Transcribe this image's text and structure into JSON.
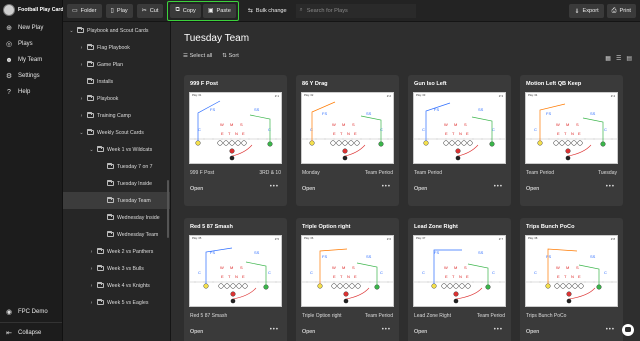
{
  "app": {
    "title": "Football Play Card"
  },
  "nav": {
    "items": [
      {
        "icon": "plus-icon",
        "glyph": "⊕",
        "label": "New Play"
      },
      {
        "icon": "plays-icon",
        "glyph": "◎",
        "label": "Plays"
      },
      {
        "icon": "team-icon",
        "glyph": "☻",
        "label": "My Team"
      },
      {
        "icon": "gear-icon",
        "glyph": "⚙",
        "label": "Settings"
      },
      {
        "icon": "help-icon",
        "glyph": "?",
        "label": "Help"
      }
    ],
    "account": "FPC Demo",
    "collapse": "Collapse"
  },
  "toolbar": {
    "folder": "Folder",
    "play": "Play",
    "cut": "Cut",
    "copy": "Copy",
    "paste": "Paste",
    "copy_marker": "1",
    "paste_marker": "2",
    "bulk_change": "Bulk change",
    "search_placeholder": "Search for Plays",
    "export": "Export",
    "print": "Print"
  },
  "tree": [
    {
      "level": 0,
      "chev": "⌄",
      "label": "Playbook and Scout Cards",
      "selected": false
    },
    {
      "level": 1,
      "chev": "›",
      "label": "Flag Playbook",
      "selected": false
    },
    {
      "level": 1,
      "chev": "›",
      "label": "Game Plan",
      "selected": false
    },
    {
      "level": 1,
      "chev": "",
      "label": "Installs",
      "selected": false
    },
    {
      "level": 1,
      "chev": "›",
      "label": "Playbook",
      "selected": false
    },
    {
      "level": 1,
      "chev": "›",
      "label": "Training Camp",
      "selected": false
    },
    {
      "level": 1,
      "chev": "⌄",
      "label": "Weekly Scout Cards",
      "selected": false
    },
    {
      "level": 2,
      "chev": "⌄",
      "label": "Week 1 vs Wildcats",
      "selected": false
    },
    {
      "level": 3,
      "chev": "",
      "label": "Tuesday 7 on 7",
      "selected": false
    },
    {
      "level": 3,
      "chev": "",
      "label": "Tuesday Inside",
      "selected": false
    },
    {
      "level": 3,
      "chev": "",
      "label": "Tuesday Team",
      "selected": true
    },
    {
      "level": 3,
      "chev": "",
      "label": "Wednesday Inside",
      "selected": false
    },
    {
      "level": 3,
      "chev": "",
      "label": "Wednesday Team",
      "selected": false
    },
    {
      "level": 2,
      "chev": "›",
      "label": "Week 2 vs Panthers",
      "selected": false
    },
    {
      "level": 2,
      "chev": "›",
      "label": "Week 3 vs Bulls",
      "selected": false
    },
    {
      "level": 2,
      "chev": "›",
      "label": "Week 4 vs Knights",
      "selected": false
    },
    {
      "level": 2,
      "chev": "›",
      "label": "Week 5 vs Eagles",
      "selected": false
    }
  ],
  "main": {
    "title": "Tuesday Team",
    "select_all": "Select all",
    "sort": "Sort"
  },
  "cards": [
    {
      "name": "999 F Post",
      "num": "# 1",
      "left": "999 F Post",
      "right": "3RD & 10",
      "head": "Play: 01",
      "formation": "F",
      "accent": "#2b6cff"
    },
    {
      "name": "86 Y Drag",
      "num": "# 2",
      "left": "Monday",
      "right": "Team Period",
      "head": "Play: 02",
      "formation": "D",
      "accent": "#ff7a00"
    },
    {
      "name": "Gun Iso Left",
      "num": "# 3",
      "left": "Team Period",
      "right": "",
      "head": "Play: 03",
      "formation": "G",
      "accent": "#2b6cff"
    },
    {
      "name": "Motion Left QB Keep",
      "num": "# 4",
      "left": "Team Period",
      "right": "Tuesday",
      "head": "Play: 04",
      "formation": "M",
      "accent": "#ff7a00"
    },
    {
      "name": "Red 5 87 Smash",
      "num": "# 5",
      "left": "Red 5 87 Smash",
      "right": "",
      "head": "Play: 05",
      "formation": "R",
      "accent": "#2b6cff"
    },
    {
      "name": "Triple Option right",
      "num": "# 6",
      "left": "Triple Option right",
      "right": "Team Period",
      "head": "Play: 06",
      "formation": "T",
      "accent": "#ff7a00"
    },
    {
      "name": "Lead Zone Right",
      "num": "# 7",
      "left": "Lead Zone Right",
      "right": "Team Period",
      "head": "Play: 07",
      "formation": "L",
      "accent": "#2b6cff"
    },
    {
      "name": "Trips Bunch PoCo",
      "num": "# 8",
      "left": "Trips Bunch PoCo",
      "right": "",
      "head": "Play: 08",
      "formation": "B",
      "accent": "#ff7a00"
    }
  ],
  "card_labels": {
    "open": "Open",
    "more": "•••"
  }
}
